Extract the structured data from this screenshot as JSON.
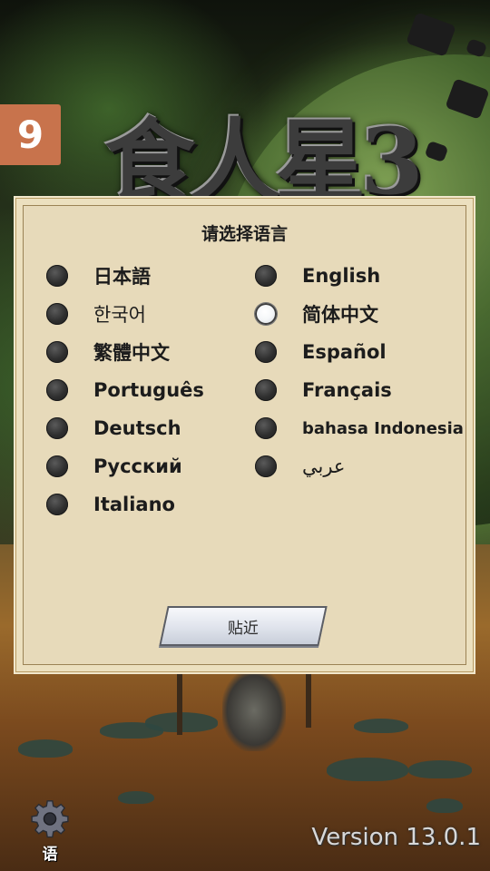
{
  "age_rating": "9",
  "game_title": "食人星3",
  "dialog": {
    "title": "请选择语言",
    "confirm_label": "贴近",
    "languages": [
      {
        "label": "日本語",
        "selected": false
      },
      {
        "label": "English",
        "selected": false
      },
      {
        "label": "한국어",
        "selected": false
      },
      {
        "label": "简体中文",
        "selected": true
      },
      {
        "label": "繁體中文",
        "selected": false
      },
      {
        "label": "Español",
        "selected": false
      },
      {
        "label": "Português",
        "selected": false
      },
      {
        "label": "Français",
        "selected": false
      },
      {
        "label": "Deutsch",
        "selected": false
      },
      {
        "label": "bahasa Indonesia",
        "selected": false
      },
      {
        "label": "Русский",
        "selected": false
      },
      {
        "label": "عربي",
        "selected": false
      },
      {
        "label": "Italiano",
        "selected": false
      }
    ]
  },
  "footer": {
    "language_button_label": "语",
    "language_button_icon": "gear-icon",
    "version": "Version 13.0.1"
  },
  "colors": {
    "dialog_bg": "#e7daba",
    "age_badge": "#c8734c",
    "selected_radio": "#f4f6f8",
    "unselected_radio": "#2e2e2e"
  }
}
